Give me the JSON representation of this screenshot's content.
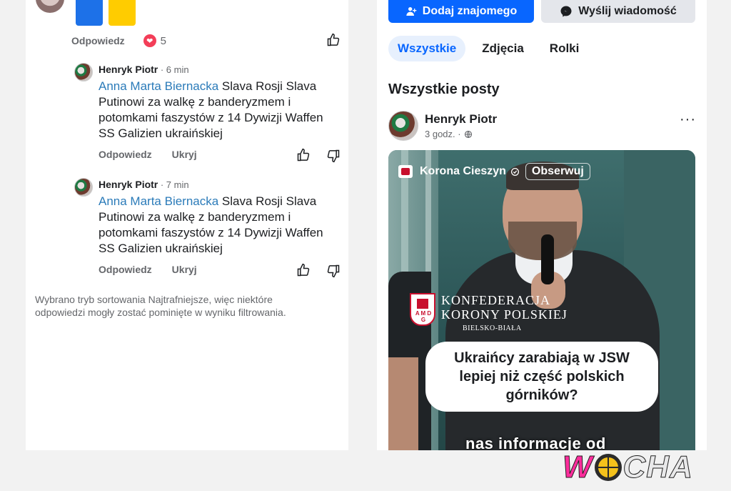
{
  "left": {
    "top_comment": {
      "reply_label": "Odpowiedz",
      "reaction_count": "5"
    },
    "replies": [
      {
        "author": "Henryk Piotr",
        "time": " · 6 min",
        "mention": "Anna Marta Biernacka",
        "text": " Slava Rosji  Slava Putinowi   za walkę z banderyzmem i potomkami faszystów z 14  Dywizji Waffen SS Galizien ukraińskiej",
        "reply_label": "Odpowiedz",
        "hide_label": "Ukryj"
      },
      {
        "author": "Henryk Piotr",
        "time": " · 7 min",
        "mention": "Anna Marta Biernacka",
        "text": " Slava Rosji  Slava Putinowi   za walkę z banderyzmem i potomkami faszystów z 14  Dywizji Waffen SS Galizien ukraińskiej",
        "reply_label": "Odpowiedz",
        "hide_label": "Ukryj"
      }
    ],
    "sort_note": "Wybrano tryb sortowania Najtrafniejsze, więc niektóre odpowiedzi mogły zostać pominięte w wyniku filtrowania."
  },
  "right": {
    "add_friend_label": "Dodaj znajomego",
    "send_message_label": "Wyślij wiadomość",
    "tabs": [
      {
        "label": "Wszystkie",
        "active": true
      },
      {
        "label": "Zdjęcia",
        "active": false
      },
      {
        "label": "Rolki",
        "active": false
      }
    ],
    "section_title": "Wszystkie posty",
    "post": {
      "author": "Henryk Piotr",
      "time": "3 godz. ·",
      "more_label": "···",
      "video": {
        "channel": "Korona Cieszyn",
        "follow_label": "Obserwuj",
        "shield_letters": "A M D G",
        "org_line1": "KONFEDERACJA",
        "org_line2": "KORONY POLSKIEJ",
        "org_line3": "BIELSKO-BIAŁA",
        "bubble_text": "Ukraińcy zarabiają w JSW lepiej niż część polskich górników?",
        "subtitle": "nas informacje od"
      }
    }
  },
  "watermark": {
    "w": "W",
    "rest": "CHA"
  },
  "colors": {
    "primary": "#0866ff",
    "mention": "#2b7bb9",
    "heart": "#f33e58"
  }
}
